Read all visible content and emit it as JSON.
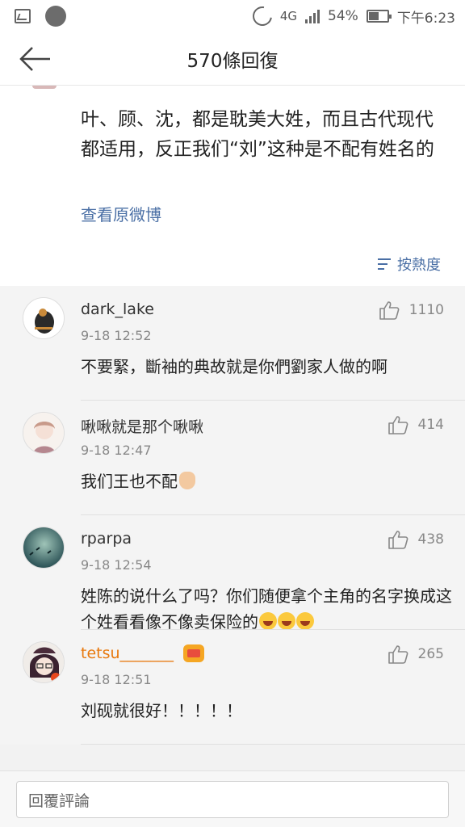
{
  "status_bar": {
    "network": "4G",
    "battery": "54%",
    "time": "下午6:23"
  },
  "header": {
    "title": "570條回復"
  },
  "post": {
    "text": "叶、顾、沈，都是耽美大姓，而且古代现代都适用，反正我们“刘”这种是不配有姓名的",
    "view_original": "查看原微博",
    "sort_label": "按熱度"
  },
  "comments": [
    {
      "username": "dark_lake",
      "time": "9-18 12:52",
      "likes": "1110",
      "text": "不要緊，斷袖的典故就是你們劉家人做的啊"
    },
    {
      "username": "啾啾就是那个啾啾",
      "time": "9-18 12:47",
      "likes": "414",
      "text": "我们王也不配"
    },
    {
      "username": "rparpa",
      "time": "9-18 12:54",
      "likes": "438",
      "text": "姓陈的说什么了吗？你们随便拿个主角的名字换成这个姓看看像不像卖保险的"
    },
    {
      "username": "tetsu_______",
      "time": "9-18 12:51",
      "likes": "265",
      "text": "刘砚就很好！！！！！"
    }
  ],
  "reply": {
    "placeholder": "回覆評論"
  },
  "colors": {
    "link": "#4a6fa5",
    "vip_name": "#e8790e"
  }
}
